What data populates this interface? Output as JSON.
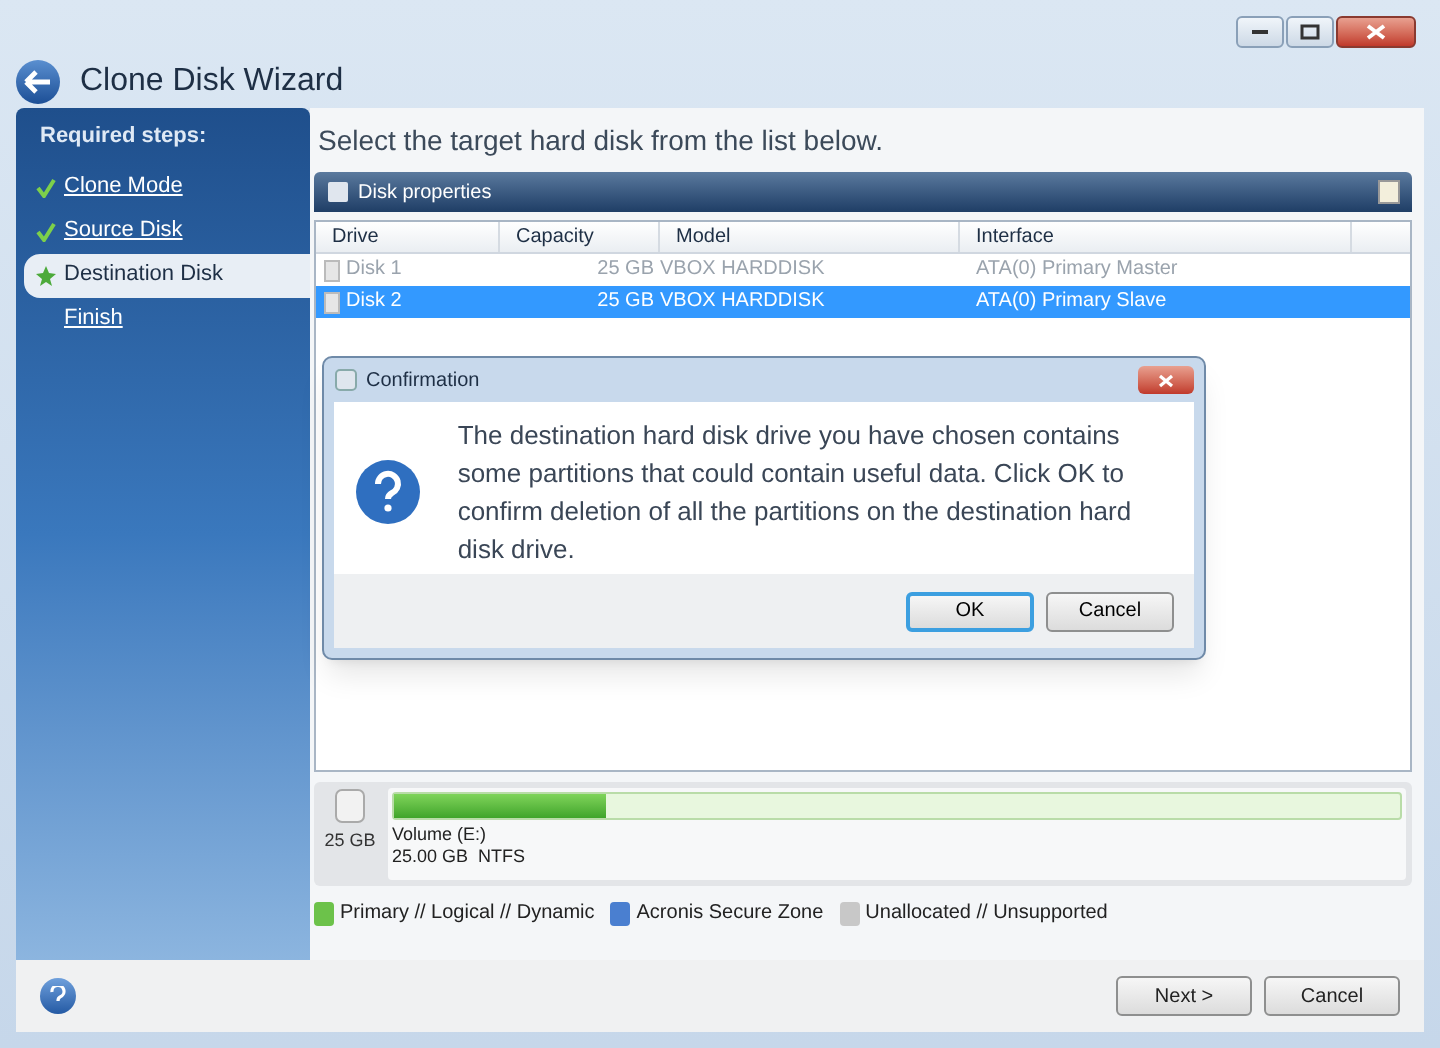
{
  "window": {
    "title": "Clone Disk Wizard"
  },
  "sidebar": {
    "heading": "Required steps:",
    "items": [
      {
        "label": "Clone Mode",
        "kind": "done",
        "selected": false
      },
      {
        "label": "Source Disk",
        "kind": "done",
        "selected": false
      },
      {
        "label": "Destination Disk",
        "kind": "current",
        "selected": true
      },
      {
        "label": "Finish",
        "kind": "pending",
        "selected": false
      }
    ]
  },
  "instruction": "Select the target hard disk from the list below.",
  "panel": {
    "title": "Disk properties"
  },
  "table": {
    "columns": [
      "Drive",
      "Capacity",
      "Model",
      "Interface"
    ],
    "rows": [
      {
        "cells": [
          "Disk 1",
          "25 GB",
          "VBOX HARDDISK",
          "ATA(0) Primary Master"
        ],
        "selected": false,
        "disabled": true
      },
      {
        "cells": [
          "Disk 2",
          "25 GB",
          "VBOX HARDDISK",
          "ATA(0) Primary Slave"
        ],
        "selected": true,
        "disabled": false
      }
    ]
  },
  "dialog": {
    "title": "Confirmation",
    "message": "The destination hard disk drive you have chosen contains some partitions that could contain useful data. Click OK to confirm deletion of all the partitions on the destination hard disk drive.",
    "buttons": [
      {
        "label": "OK",
        "default": true
      },
      {
        "label": "Cancel",
        "default": false
      }
    ]
  },
  "partition": {
    "disk_size": "25 GB",
    "level": 0.21,
    "volume": "Volume (E:)",
    "details": "25.00 GB  NTFS"
  },
  "legend": [
    {
      "label": "Primary // Logical // Dynamic",
      "color": "#6cc24a"
    },
    {
      "label": "Acronis Secure Zone",
      "color": "#4a7fd0"
    },
    {
      "label": "Unallocated // Unsupported",
      "color": "#c8c8c8"
    }
  ],
  "buttons": [
    "Next >",
    "Cancel"
  ]
}
